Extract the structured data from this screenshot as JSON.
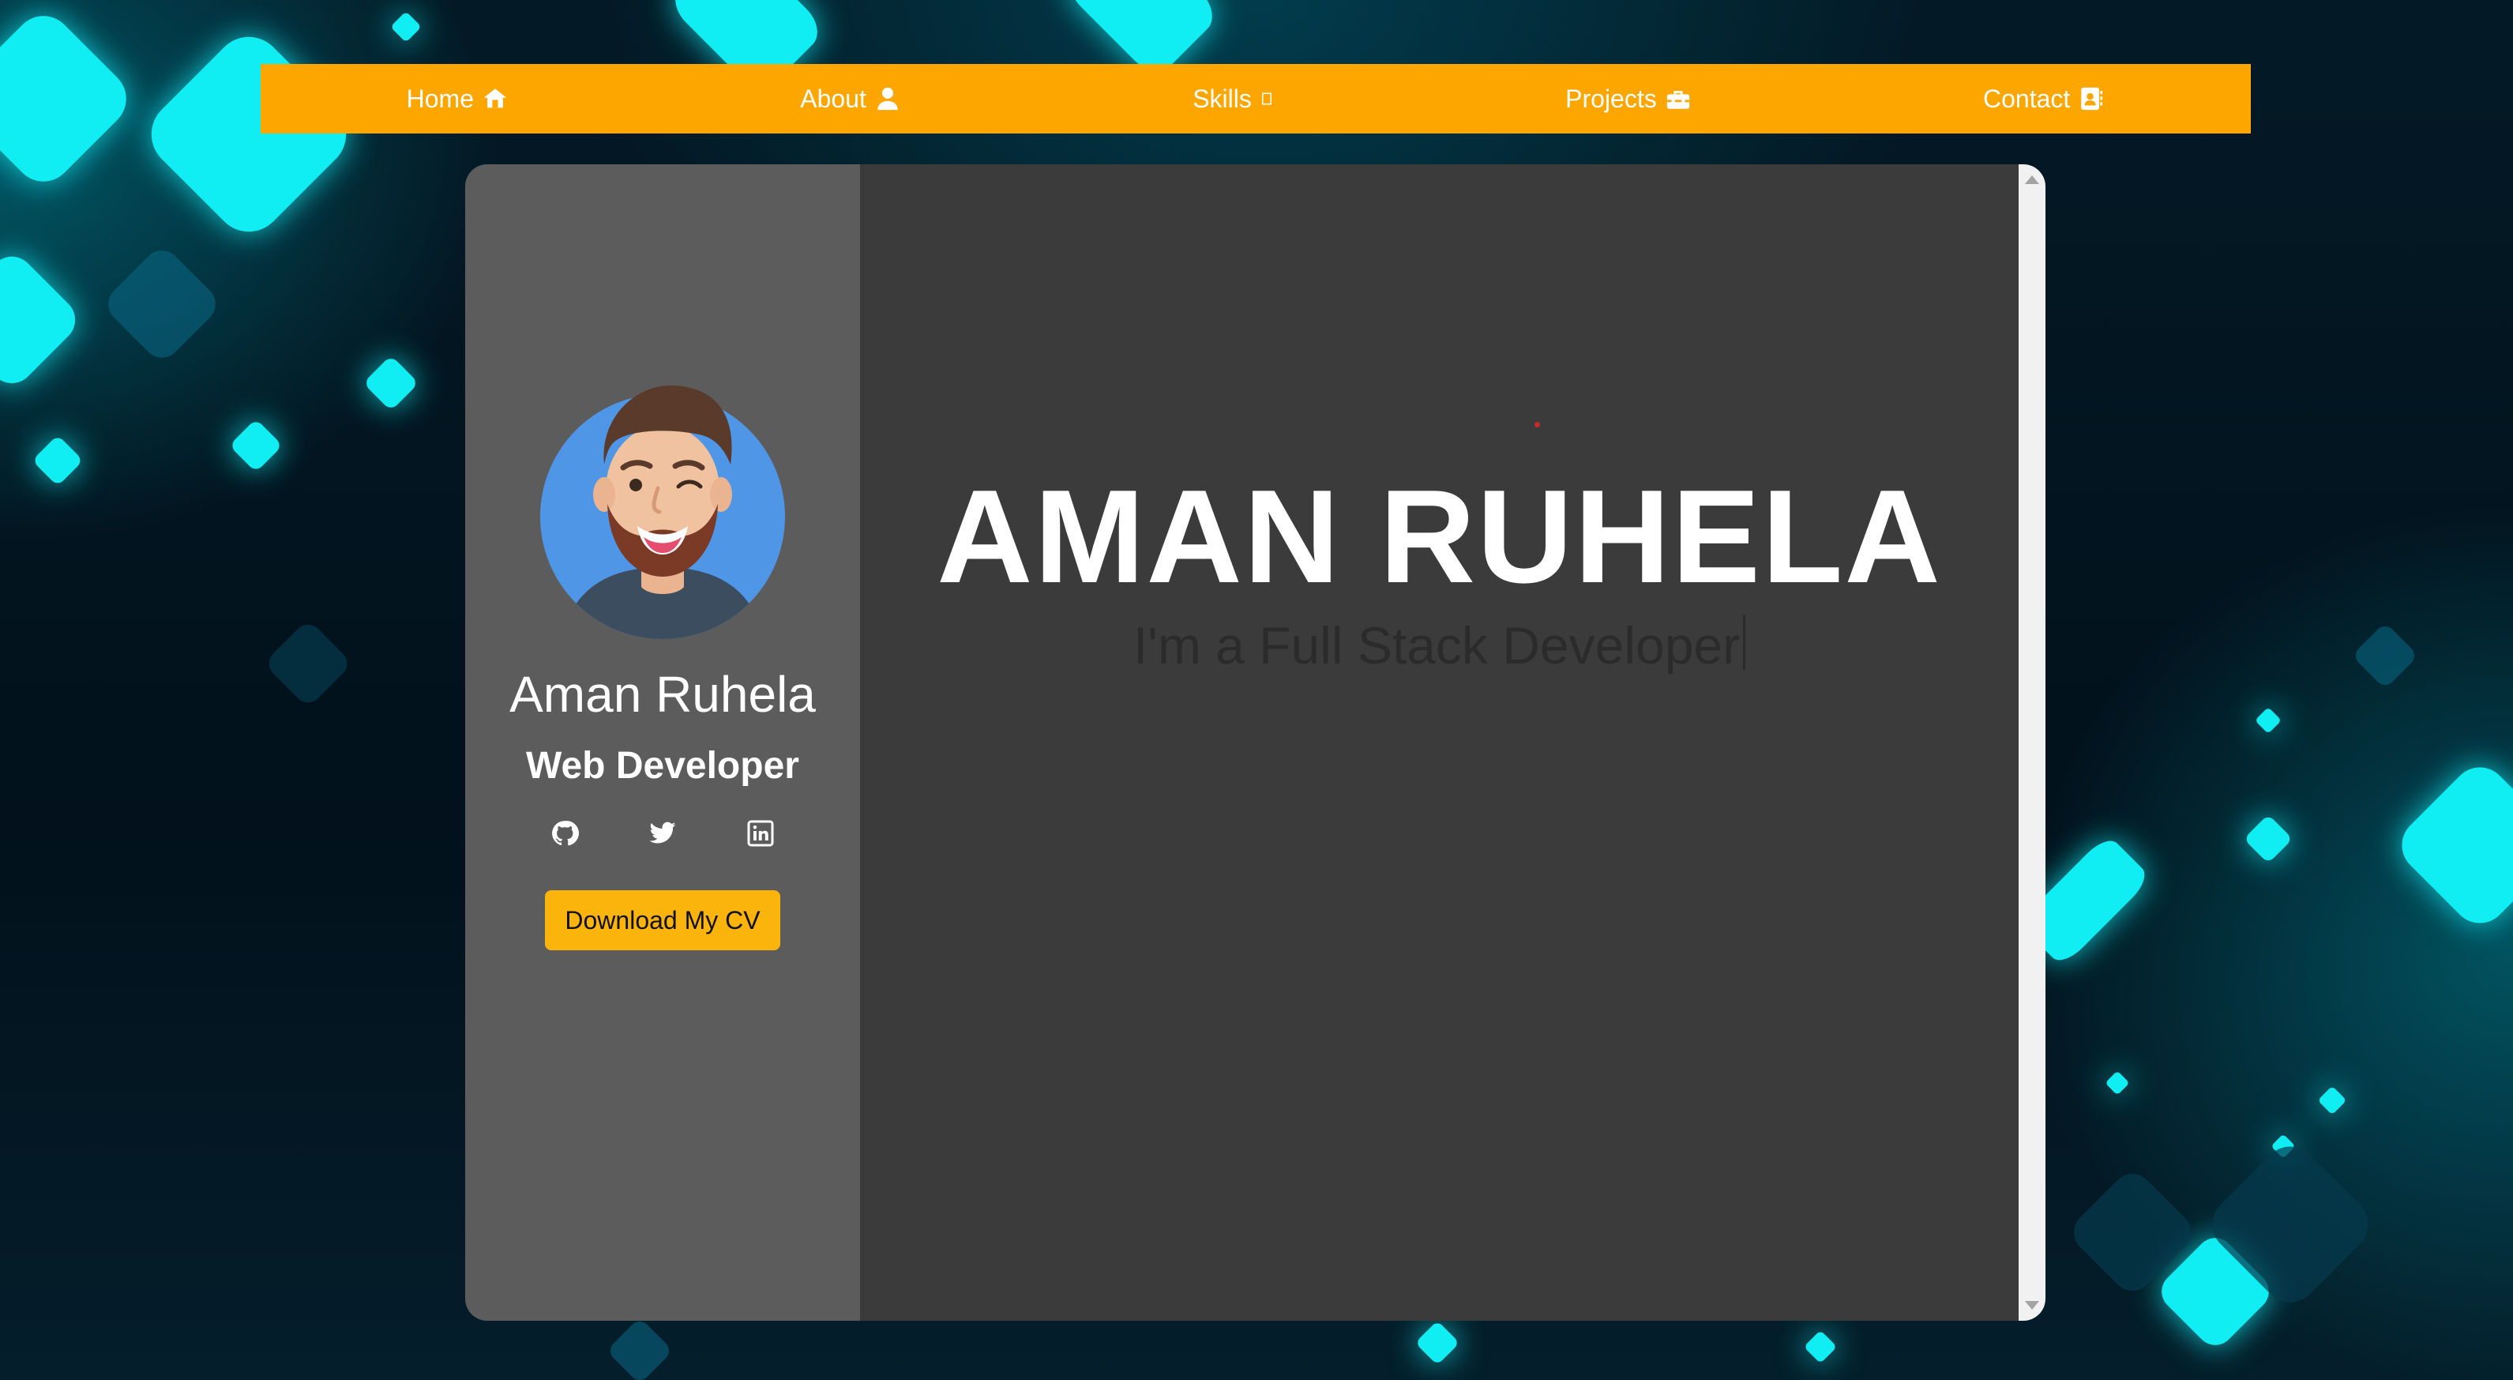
{
  "navbar": {
    "items": [
      {
        "label": "Home",
        "icon": "house-icon"
      },
      {
        "label": "About",
        "icon": "user-icon"
      },
      {
        "label": "Skills",
        "icon": "missing-glyph-icon"
      },
      {
        "label": "Projects",
        "icon": "toolbox-icon"
      },
      {
        "label": "Contact",
        "icon": "address-book-icon"
      }
    ],
    "background": "#fea600"
  },
  "profile": {
    "name": "Aman Ruhela",
    "role": "Web Developer",
    "avatar": "avatar-icon",
    "social": [
      "github-icon",
      "twitter-icon",
      "linkedin-icon"
    ],
    "cv_button": "Download My CV"
  },
  "hero": {
    "name": "AMAN RUHELA",
    "tagline": "I'm a Full Stack Developer"
  },
  "colors": {
    "accent": "#fea600",
    "button": "#fbb40c",
    "sidebar": "#5d5c5d",
    "panel": "#3c3b3b",
    "glow": "#10eef4"
  }
}
